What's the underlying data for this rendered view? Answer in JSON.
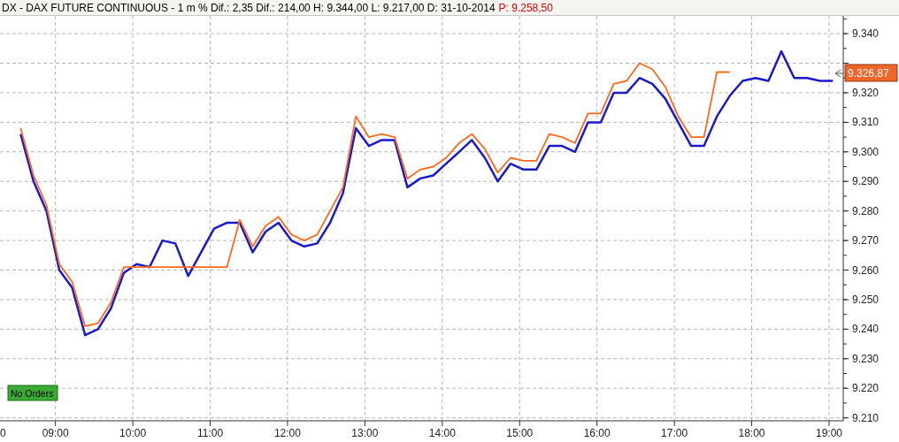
{
  "header": {
    "title": "DX - DAX FUTURE CONTINUOUS - 1 m % Dif.: 2,35 Dif.: 214,00 H: 9.344,00 L: 9.217,00 D: 31-10-2014",
    "price": "P: 9.258,50"
  },
  "chart": {
    "last_price": "9.326,87",
    "cut_label": "0",
    "badge": "No Orders",
    "chart_data": {
      "type": "line",
      "grid": true,
      "x": [
        513,
        523,
        533,
        543,
        553,
        563,
        573,
        583,
        593,
        603,
        613,
        623,
        633,
        643,
        653,
        663,
        673,
        683,
        693,
        703,
        713,
        723,
        733,
        743,
        753,
        763,
        773,
        783,
        793,
        803,
        813,
        823,
        833,
        843,
        853,
        863,
        873,
        883,
        893,
        903,
        913,
        923,
        933,
        943,
        953,
        963,
        973,
        983,
        993,
        1003,
        1013,
        1023,
        1033,
        1043,
        1053,
        1063,
        1073,
        1083,
        1093,
        1103,
        1113,
        1123,
        1133,
        1143
      ],
      "xlim": [
        497,
        1151
      ],
      "series": [
        {
          "color": "#1a1acc",
          "values": [
            9306,
            9290,
            9280,
            9260,
            9254,
            9238,
            9240,
            9247,
            9259,
            9262,
            9261,
            9270,
            9269,
            9258,
            9266,
            9274,
            9276,
            9276,
            9266,
            9273,
            9276,
            9270,
            9268,
            9269,
            9276,
            9286,
            9308,
            9302,
            9304,
            9304,
            9288,
            9291,
            9292,
            9296,
            9300,
            9304,
            9298,
            9290,
            9296,
            9294,
            9294,
            9302,
            9302,
            9300,
            9310,
            9310,
            9320,
            9320,
            9325,
            9323,
            9318,
            9310,
            9302,
            9302,
            9312,
            9319,
            9324,
            9325,
            9324,
            9334,
            9325,
            9325,
            9324,
            9324
          ]
        },
        {
          "color": "#ff6a1a",
          "values": [
            9308,
            9292,
            9282,
            9262,
            9256,
            9241,
            9242,
            9249,
            9261,
            9261,
            9261,
            9261,
            9261,
            9261,
            9261,
            9261,
            9261,
            9277,
            9268,
            9275,
            9278,
            9272,
            9270,
            9272,
            9280,
            9288,
            9312,
            9305,
            9306,
            9305,
            9291,
            9294,
            9295,
            9298,
            9303,
            9306,
            9301,
            9293,
            9298,
            9297,
            9297,
            9306,
            9305,
            9303,
            9313,
            9313,
            9323,
            9324,
            9330,
            9328,
            9322,
            9312,
            9305,
            9305,
            9327,
            9327,
            null,
            null,
            null,
            null,
            null,
            null,
            null,
            null
          ]
        }
      ],
      "ylim": [
        9209,
        9346
      ],
      "yticks": [
        {
          "value": 9210,
          "label": "9.210"
        },
        {
          "value": 9220,
          "label": "9.220"
        },
        {
          "value": 9230,
          "label": "9.230"
        },
        {
          "value": 9240,
          "label": "9.240"
        },
        {
          "value": 9250,
          "label": "9.250"
        },
        {
          "value": 9260,
          "label": "9.260"
        },
        {
          "value": 9270,
          "label": "9.270"
        },
        {
          "value": 9280,
          "label": "9.280"
        },
        {
          "value": 9290,
          "label": "9.290"
        },
        {
          "value": 9300,
          "label": "9.300"
        },
        {
          "value": 9310,
          "label": "9.310"
        },
        {
          "value": 9320,
          "label": "9.320"
        },
        {
          "value": 9340,
          "label": "9.340"
        }
      ],
      "xticks": [
        {
          "value": 540,
          "label": "09:00"
        },
        {
          "value": 600,
          "label": "10:00"
        },
        {
          "value": 660,
          "label": "11:00"
        },
        {
          "value": 720,
          "label": "12:00"
        },
        {
          "value": 780,
          "label": "13:00"
        },
        {
          "value": 840,
          "label": "14:00"
        },
        {
          "value": 900,
          "label": "15:00"
        },
        {
          "value": 960,
          "label": "16:00"
        },
        {
          "value": 1020,
          "label": "17:00"
        },
        {
          "value": 1080,
          "label": "18:00"
        },
        {
          "value": 1140,
          "label": "19:00"
        }
      ]
    }
  }
}
